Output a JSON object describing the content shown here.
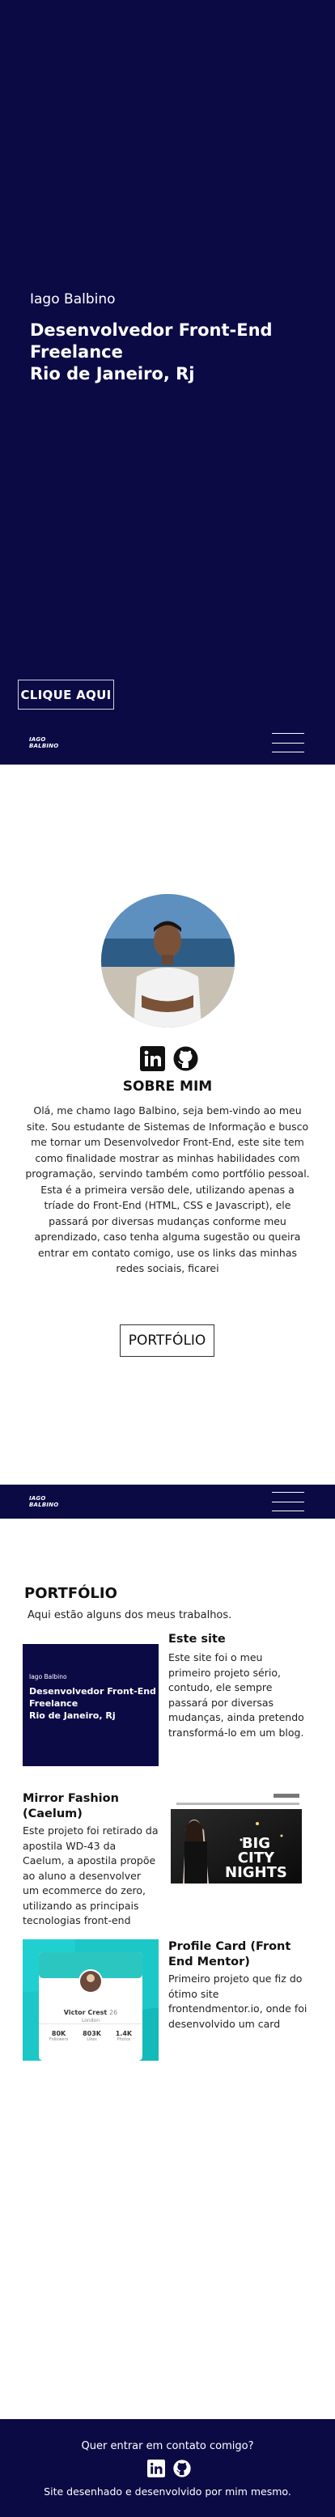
{
  "hero": {
    "greeting": "Iago Balbino",
    "role_line1": "Desenvolvedor Front-End",
    "role_line2": "Freelance",
    "role_line3": "Rio de Janeiro, Rj",
    "cta_label": "CLIQUE AQUI"
  },
  "navbar": {
    "logo_line1": "IAGO",
    "logo_line2": "BALBINO"
  },
  "about": {
    "heading": "SOBRE MIM",
    "bio": "Olá, me chamo Iago Balbino, seja bem-vindo ao meu site. Sou estudante de Sistemas de Informação e busco me tornar um Desenvolvedor Front-End, este site tem como finalidade mostrar as minhas habilidades com programação, servindo também como portfólio pessoal. Esta é a primeira versão dele, utilizando apenas a tríade do Front-End (HTML, CSS e Javascript), ele passará por diversas mudanças conforme meu aprendizado, caso tenha alguma sugestão ou queira entrar em contato comigo, use os links das minhas redes sociais, ficarei",
    "portfolio_button": "PORTFÓLIO"
  },
  "portfolio": {
    "heading": "PORTFÓLIO",
    "subtitle": "Aqui estão alguns dos meus trabalhos.",
    "projects": [
      {
        "title": "Este site",
        "description": "Este site foi o meu primeiro projeto sério, contudo, ele sempre passará por diversas mudanças, ainda pretendo transformá-lo em um blog.",
        "thumb_line1": "Iago Balbino",
        "thumb_line2": "Desenvolvedor Front-End",
        "thumb_line3": "Freelance",
        "thumb_line4": "Rio de Janeiro, Rj"
      },
      {
        "title": "Mirror Fashion (Caelum)",
        "description": "Este projeto foi retirado da apostila WD-43 da Caelum, a apostila propõe ao aluno a desenvolver um ecommerce do zero, utilizando as principais tecnologias front-end",
        "thumb_text1": "BIG",
        "thumb_text2": "CITY",
        "thumb_text3": "NIGHTS"
      },
      {
        "title": "Profile Card (Front End Mentor)",
        "description": "Primeiro projeto que fiz do ótimo site frontendmentor.io, onde foi desenvolvido um card",
        "card_name": "Victor Crest",
        "card_age": "26",
        "card_city": "London",
        "stats": [
          {
            "value": "80K",
            "label": "Followers"
          },
          {
            "value": "803K",
            "label": "Likes"
          },
          {
            "value": "1.4K",
            "label": "Photos"
          }
        ]
      }
    ]
  },
  "footer": {
    "question": "Quer entrar em contato comigo?",
    "credits": "Site desenhado e desenvolvido por mim mesmo."
  },
  "colors": {
    "brand_navy": "#0c0a45",
    "card_teal": "#1cc7c7"
  },
  "icons": [
    "linkedin-icon",
    "github-icon",
    "hamburger-menu-icon"
  ]
}
